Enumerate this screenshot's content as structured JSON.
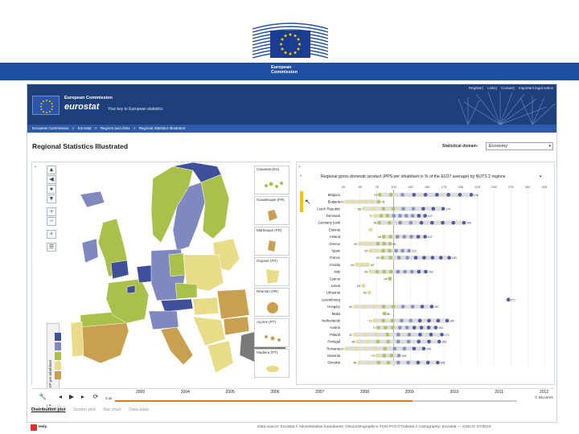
{
  "banner": {
    "logo_line1": "European",
    "logo_line2": "Commission",
    "colors": {
      "blue": "#1f4fa0",
      "flag": "#1a3d8f",
      "star": "#f5c400"
    }
  },
  "site": {
    "top_links": [
      "Register",
      "Links",
      "Contact",
      "Important legal notice"
    ],
    "brand_ec": "European Commission",
    "brand_eurostat": "eurostat",
    "brand_tagline": "Your key to European statistics",
    "breadcrumb": [
      "European Commission",
      ">",
      "Eurostat",
      ">",
      "Regions and cities",
      ">",
      "Regional Statistics Illustrated"
    ],
    "page_title": "Regional Statistics Illustrated",
    "domain_label": "Statistical domain:",
    "domain_value": "Economy"
  },
  "map": {
    "insets": [
      "Canarias (ES)",
      "Guadeloupe (FR)",
      "Martinique (FR)",
      "Guyane (FR)",
      "Réunion (FR)",
      "Açores (PT)",
      "Madeira (PT)"
    ],
    "legend_title": "Regional GDP per inhabitant",
    "icons": [
      "arrow-up-icon",
      "arrow-left-icon",
      "arrow-right-icon",
      "arrow-down-icon",
      "zoom-in-icon",
      "zoom-out-icon",
      "fullscreen-icon",
      "list-icon"
    ],
    "legend_colors": [
      "#3f4f9a",
      "#8088c0",
      "#a9c04a",
      "#e8dc88",
      "#c8a050"
    ]
  },
  "chart": {
    "title": "Regional gross domestic product (PPS per inhabitant in % of the EU27 average) by NUTS 2 regions"
  },
  "chart_data": {
    "type": "scatter",
    "title": "Regional gross domestic product (PPS per inhabitant in % of the EU27 average) by NUTS 2 regions",
    "x_ticks": [
      25,
      50,
      75,
      100,
      125,
      150,
      175,
      200,
      225,
      250,
      275,
      300,
      325
    ],
    "xlim": [
      25,
      325
    ],
    "categories": [
      "Belgium",
      "Bulgaria",
      "Czech Republic",
      "Denmark",
      "Germany (until 1990 former territory of the FRG)",
      "Estonia",
      "Ireland",
      "Greece",
      "Spain",
      "France",
      "Croatia",
      "Italy",
      "Cyprus",
      "Latvia",
      "Lithuania",
      "Luxembourg",
      "Hungary",
      "Malta",
      "Netherlands",
      "Austria",
      "Poland",
      "Portugal",
      "Romania",
      "Slovenia",
      "Slovakia"
    ],
    "row_labels": [
      "Belgium",
      "Bulgaria",
      "Czech Republic",
      "Denmark",
      "Germany (until",
      "Estonia",
      "Ireland",
      "Greece",
      "Spain",
      "France",
      "Croatia",
      "Italy",
      "Cyprus",
      "Latvia",
      "Lithuania",
      "Luxembourg",
      "Hungary",
      "Malta",
      "Netherlands",
      "Austria",
      "Poland",
      "Portugal",
      "Romania",
      "Slovenia",
      "Slovakia"
    ],
    "ranges": [
      [
        79,
        216
      ],
      [
        29,
        78
      ],
      [
        55,
        174
      ],
      [
        72,
        147
      ],
      [
        78,
        205
      ],
      [
        65,
        65
      ],
      [
        85,
        147
      ],
      [
        49,
        95
      ],
      [
        65,
        123
      ],
      [
        83,
        183
      ],
      [
        44,
        62
      ],
      [
        65,
        148
      ],
      [
        94,
        94
      ],
      [
        54,
        54
      ],
      [
        63,
        63
      ],
      [
        271,
        271
      ],
      [
        42,
        157
      ],
      [
        86,
        86
      ],
      [
        71,
        180
      ],
      [
        77,
        163
      ],
      [
        42,
        172
      ],
      [
        46,
        168
      ],
      [
        29,
        145
      ],
      [
        75,
        108
      ],
      [
        48,
        166
      ]
    ],
    "min_labels": [
      "79",
      "29",
      "55",
      "72",
      "78",
      "",
      "65",
      "49",
      "65",
      "83",
      "44",
      "65",
      "94",
      "54",
      "63",
      "",
      "42",
      "",
      "71",
      "77",
      "42",
      "46",
      "29",
      "75",
      "48"
    ],
    "max_labels": [
      "216",
      "78",
      "174",
      "147",
      "205",
      "",
      "147",
      "95",
      "123",
      "183",
      "62",
      "148",
      "",
      "",
      "",
      "271",
      "157",
      "86",
      "180",
      "163",
      "172",
      "168",
      "145",
      "108",
      "166"
    ],
    "point_colors": [
      "#3f4f9a",
      "#8088c0",
      "#a9c04a",
      "#e8dc88"
    ]
  },
  "timeline": {
    "years": [
      "2005",
      "2004",
      "2005",
      "2006",
      "2007",
      "2008",
      "2009",
      "2010",
      "2011",
      "2012"
    ],
    "speed_label": "0.4x",
    "progress": 0.74,
    "copyright": "© NComVA"
  },
  "view_tabs": [
    "Distribution plot",
    "Scatter plot",
    "Bar chart",
    "Data table"
  ],
  "footer": {
    "help": "Help",
    "source": "Data source: Eurostat // Administrative boundaries: ©EuroGeographics ©UN-FAO ©Turkstat // Cartography: Eurostat — GISCO, 07/2013"
  }
}
